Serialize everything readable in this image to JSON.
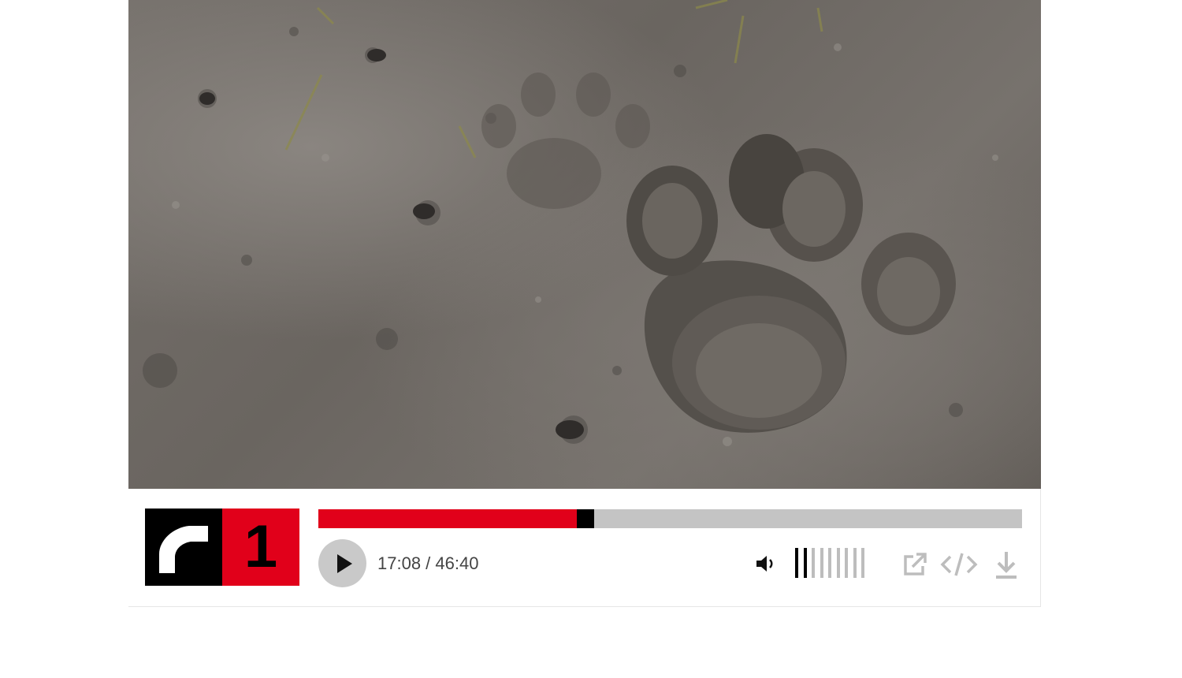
{
  "player": {
    "cover_image": "wolf-paw-print-in-mud",
    "logo": {
      "number": "1",
      "icon": "radio-wave-icon",
      "colors": {
        "black": "#000000",
        "red": "#e1001a"
      }
    },
    "progress": {
      "played_fraction": 0.3671,
      "played_color": "#e1001a",
      "track_color": "#c4c4c4"
    },
    "play_icon": "play-icon",
    "time_display": "17:08 / 46:40",
    "volume": {
      "icon": "speaker-icon",
      "level": 2,
      "max": 9
    },
    "actions": [
      "external-link-icon",
      "embed-code-icon",
      "download-icon"
    ]
  }
}
